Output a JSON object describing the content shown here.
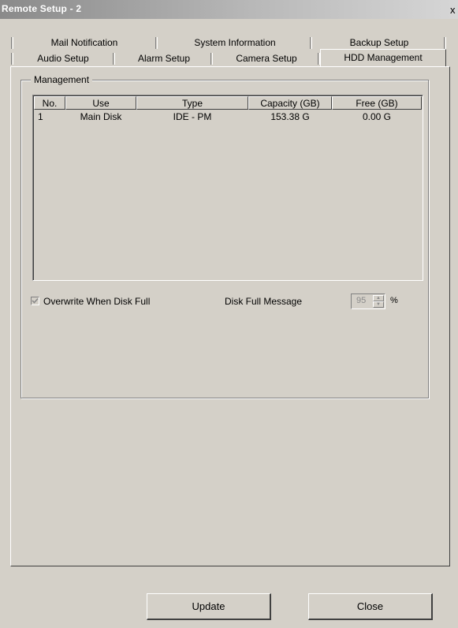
{
  "window": {
    "title": "Remote Setup - 2",
    "close_glyph": "x"
  },
  "tabs": {
    "row_back": [
      {
        "label": "Mail Notification"
      },
      {
        "label": "System Information"
      },
      {
        "label": "Backup Setup"
      }
    ],
    "row_front": [
      {
        "label": "Audio Setup"
      },
      {
        "label": "Alarm Setup"
      },
      {
        "label": "Camera Setup"
      },
      {
        "label": "HDD Management",
        "active": true
      }
    ]
  },
  "management": {
    "group_label": "Management",
    "columns": [
      "No.",
      "Use",
      "Type",
      "Capacity (GB)",
      "Free (GB)"
    ],
    "rows": [
      [
        "1",
        "Main Disk",
        "IDE - PM",
        "153.38 G",
        "0.00 G"
      ]
    ],
    "overwrite_label": "Overwrite When Disk Full",
    "overwrite_checked": true,
    "disk_full_message_label": "Disk Full Message",
    "disk_full_message_value": "95",
    "percent_sign": "%"
  },
  "buttons": {
    "update": "Update",
    "close": "Close"
  }
}
